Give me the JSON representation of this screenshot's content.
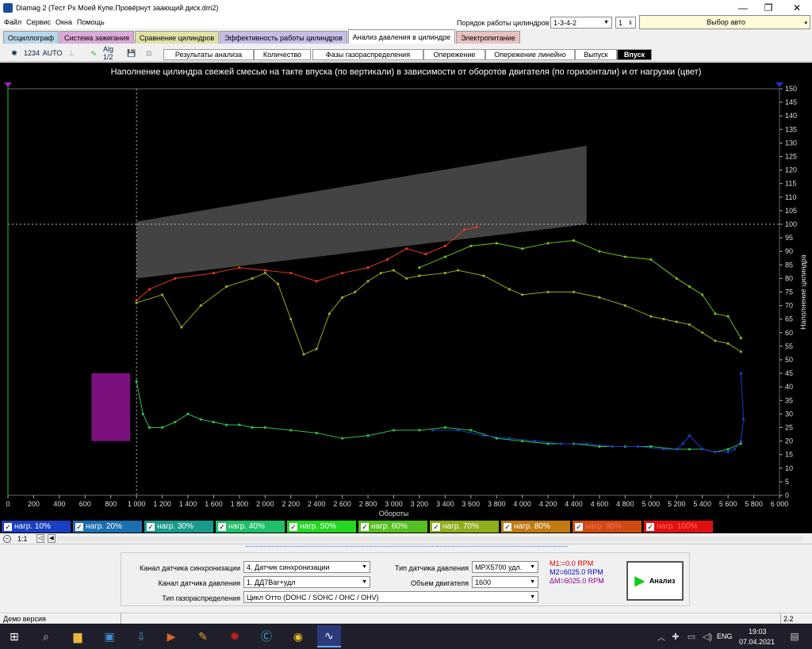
{
  "window": {
    "title": "Diamag 2 (Тест Рх Моей Купе.Провёрнут заающий диск.dm2)"
  },
  "menu": [
    "Файл",
    "Сервис",
    "Окна",
    "Помощь"
  ],
  "header": {
    "order_label": "Порядок работы цилиндров",
    "order_value": "1-3-4-2",
    "cyl_value": "1",
    "auto_select": "Выбор авто"
  },
  "tabs": [
    {
      "label": "Осциллограф",
      "color": "#b9d7ea"
    },
    {
      "label": "Система зажигания",
      "color": "#dca9d8"
    },
    {
      "label": "Сравнение цилиндров",
      "color": "#e0e0a8"
    },
    {
      "label": "Эффективность работы цилиндров",
      "color": "#c8bde8"
    },
    {
      "label": "Анализ давления в цилиндре",
      "color": "#ffffff"
    },
    {
      "label": "Электропитание",
      "color": "#e8c0c0"
    }
  ],
  "toolbar": {
    "alg_label": "Alg 1/2",
    "auto_label": "AUTO",
    "count_label": "1234"
  },
  "subtabs": [
    "Результаты анализа",
    "Количество",
    "Фазы газораспределения",
    "Опережение",
    "Опережение линейно",
    "Выпуск",
    "Впуск"
  ],
  "plot": {
    "title": "Наполнение цилиндра свежей смесью на такте впуска (по вертикали) в зависимости от оборотов двигателя (по горизонтали) и от нагрузки (цвет)",
    "xlabel": "Обороты",
    "ylabel": "Наполнение цилиндра"
  },
  "chart_data": {
    "type": "line",
    "title": "Наполнение цилиндра свежей смесью на такте впуска (по вертикали) в зависимости от оборотов двигателя (по горизонтали) и от нагрузки (цвет)",
    "xlabel": "Обороты",
    "ylabel": "Наполнение цилиндра",
    "xlim": [
      0,
      6000
    ],
    "ylim": [
      0,
      150
    ],
    "x_ticks": [
      "0",
      "200",
      "400",
      "600",
      "800",
      "1 000",
      "1 200",
      "1 400",
      "1 600",
      "1 800",
      "2 000",
      "2 200",
      "2 400",
      "2 600",
      "2 800",
      "3 000",
      "3 200",
      "3 400",
      "3 600",
      "3 800",
      "4 000",
      "4 200",
      "4 400",
      "4 600",
      "4 800",
      "5 000",
      "5 200",
      "5 400",
      "5 600",
      "5 800",
      "6 000"
    ],
    "y_ticks": [
      "0",
      "5",
      "10",
      "15",
      "20",
      "25",
      "30",
      "35",
      "40",
      "45",
      "50",
      "55",
      "60",
      "65",
      "70",
      "75",
      "80",
      "85",
      "90",
      "95",
      "100",
      "105",
      "110",
      "115",
      "120",
      "125",
      "130",
      "135",
      "140",
      "145",
      "150"
    ],
    "markers": {
      "vertical_x": 1000,
      "horizontal_y": 100
    },
    "reference_band": {
      "x": [
        1000,
        4500
      ],
      "y_low": [
        80,
        100
      ],
      "y_high": [
        101,
        129
      ],
      "color": "#4a4a4a"
    },
    "idle_box": {
      "x": [
        650,
        950
      ],
      "y": [
        20,
        45
      ],
      "color": "#7a117e"
    },
    "series": [
      {
        "name": "нагр. 90%",
        "color": "#e03a1a",
        "x": [
          1000,
          1100,
          1300,
          1600,
          1800,
          2000,
          2200,
          2400,
          2600,
          2800,
          2950,
          3100,
          3250,
          3400,
          3550,
          3650
        ],
        "y": [
          72,
          76,
          80,
          82,
          84,
          83,
          82,
          79,
          82,
          84,
          87,
          91,
          89,
          92,
          98,
          99
        ]
      },
      {
        "name": "нагр. 70%",
        "color": "#8fae1c",
        "x": [
          1000,
          1200,
          1350,
          1500,
          1700,
          1900,
          2000,
          2100,
          2200,
          2300,
          2400,
          2500,
          2600,
          2700,
          2800,
          2900,
          3000,
          3100,
          3200,
          3400,
          3500,
          3700,
          3900,
          4000,
          4200,
          4400,
          4600,
          4800,
          5000,
          5100,
          5200,
          5300,
          5400,
          5500,
          5600,
          5700
        ],
        "y": [
          71,
          74,
          62,
          70,
          77,
          80,
          82,
          78,
          65,
          52,
          54,
          67,
          73,
          75,
          79,
          82,
          83,
          80,
          81,
          82,
          83,
          81,
          76,
          74,
          75,
          75,
          73,
          70,
          66,
          65,
          64,
          63,
          60,
          57,
          56,
          53
        ]
      },
      {
        "name": "нагр. 60%",
        "color": "#6fbf1a",
        "x": [
          3200,
          3400,
          3600,
          3800,
          4000,
          4200,
          4400,
          4600,
          4800,
          5000,
          5200,
          5300,
          5400,
          5500,
          5600,
          5700
        ],
        "y": [
          84,
          88,
          92,
          93,
          91,
          93,
          94,
          90,
          88,
          87,
          80,
          77,
          74,
          67,
          66,
          58
        ]
      },
      {
        "name": "нагр. 50%",
        "color": "#2fc04a",
        "x": [
          1000,
          1050,
          1100,
          1200,
          1300,
          1400,
          1500,
          1600,
          1700,
          1800,
          1900,
          2000,
          2200,
          2400,
          2600,
          2800,
          3000,
          3200,
          3400,
          3600,
          3800,
          4000,
          4200,
          4400,
          4600,
          4800,
          5000,
          5200,
          5300,
          5400,
          5500,
          5600,
          5700
        ],
        "y": [
          42,
          30,
          25,
          25,
          27,
          30,
          28,
          27,
          26,
          26,
          25,
          25,
          24,
          23,
          21,
          22,
          24,
          24,
          25,
          24,
          21,
          20,
          19,
          19,
          18,
          18,
          18,
          17,
          17,
          17,
          16,
          17,
          19
        ]
      },
      {
        "name": "нагр. 10%",
        "color": "#1a3fc0",
        "x": [
          3300,
          3500,
          3700,
          3900,
          4100,
          4300,
          4500,
          4700,
          4900,
          5100,
          5200,
          5250,
          5300,
          5400,
          5500,
          5600,
          5650,
          5700,
          5720,
          5700
        ],
        "y": [
          24,
          24,
          22,
          21,
          20,
          19,
          19,
          18,
          18,
          17,
          17,
          19,
          22,
          17,
          16,
          16,
          17,
          20,
          28,
          45
        ]
      }
    ]
  },
  "legend": [
    {
      "label": "нагр. 10%",
      "color": "#1a3fc0"
    },
    {
      "label": "нагр. 20%",
      "color": "#1a6fb0"
    },
    {
      "label": "нагр. 30%",
      "color": "#1a9a8c"
    },
    {
      "label": "нагр. 40%",
      "color": "#1ec06a"
    },
    {
      "label": "нагр. 50%",
      "color": "#22d822"
    },
    {
      "label": "нагр. 60%",
      "color": "#55c020"
    },
    {
      "label": "нагр. 70%",
      "color": "#8fae1c"
    },
    {
      "label": "нагр. 80%",
      "color": "#c07a10"
    },
    {
      "label": "нагр. 90%",
      "color": "#d04a10"
    },
    {
      "label": "нагр. 100%",
      "color": "#e01010"
    }
  ],
  "zoom": {
    "ratio": "1:1"
  },
  "panel": {
    "sync_label": "Канал датчика синхронизации",
    "sync_value": "4.  Датчик синхронизации",
    "pressure_ch_label": "Канал датчика давления",
    "pressure_ch_value": "1.  ДД7Ваг+удл",
    "timing_label": "Тип газораспределения",
    "timing_value": "Цикл Отто (DOHC / SOHC / OHC / OHV)",
    "sensor_type_label": "Тип датчика давления",
    "sensor_type_value": "MPX5700 удл.",
    "volume_label": "Объем двигателя",
    "volume_value": "1600",
    "m1": "M1:=0.0 RPM",
    "m2": "M2=6025.0 RPM",
    "dm": "ΔM=6025.0 RPM",
    "analyze": "Анализ"
  },
  "status": {
    "left": "Демо версия",
    "right": "2.2"
  },
  "taskbar": {
    "lang": "ENG",
    "time": "19:03",
    "date": "07.04.2021"
  }
}
